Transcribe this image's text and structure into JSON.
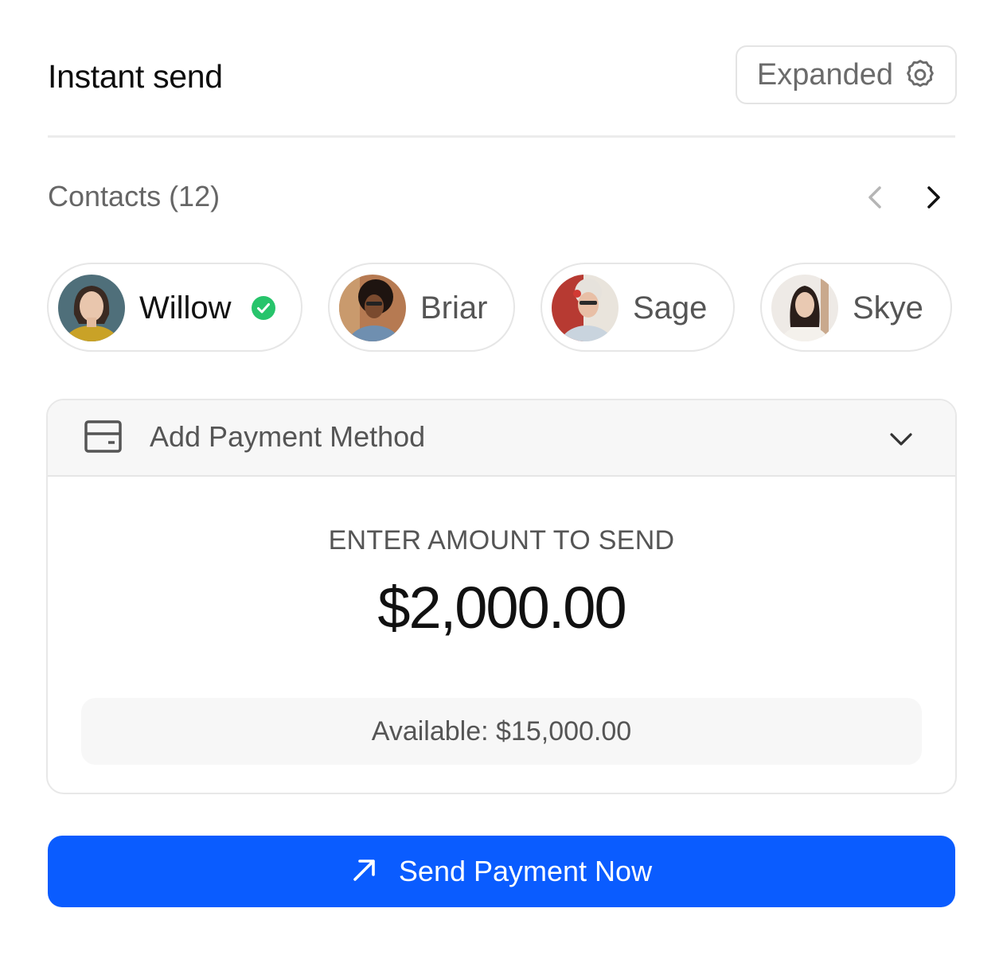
{
  "header": {
    "title": "Instant send",
    "mode_label": "Expanded",
    "mode_icon": "gear-icon"
  },
  "contacts": {
    "title": "Contacts (12)",
    "prev_icon": "chevron-left-icon",
    "next_icon": "chevron-right-icon",
    "items": [
      {
        "name": "Willow",
        "selected": true
      },
      {
        "name": "Briar",
        "selected": false
      },
      {
        "name": "Sage",
        "selected": false
      },
      {
        "name": "Skye",
        "selected": false
      }
    ]
  },
  "payment_method": {
    "label": "Add Payment Method",
    "icon": "card-icon",
    "chevron_icon": "chevron-down-icon"
  },
  "amount": {
    "label": "ENTER AMOUNT TO SEND",
    "value": "$2,000.00",
    "available": "Available: $15,000.00"
  },
  "send_button": {
    "label": "Send Payment Now",
    "icon": "arrow-up-right-icon"
  },
  "colors": {
    "accent": "#0a5cff",
    "success": "#27c46b"
  }
}
